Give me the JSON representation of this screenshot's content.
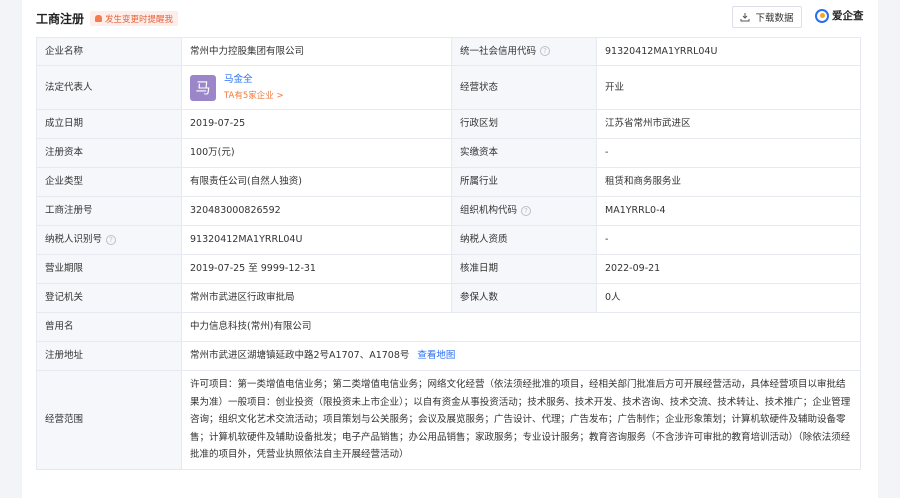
{
  "header": {
    "title": "工商注册",
    "alert": "发生变更时提醒我",
    "download_label": "下载数据",
    "logo_text": "爱企查"
  },
  "rows": [
    {
      "l1": "企业名称",
      "v1": "常州中力控股集团有限公司",
      "l2": "统一社会信用代码",
      "v2": "91320412MA1YRRL04U"
    },
    {
      "l1": "法定代表人",
      "l2": "经营状态",
      "v2": "开业"
    },
    {
      "l1": "成立日期",
      "v1": "2019-07-25",
      "l2": "行政区划",
      "v2": "江苏省常州市武进区"
    },
    {
      "l1": "注册资本",
      "v1": "100万(元)",
      "l2": "实缴资本",
      "v2": "-"
    },
    {
      "l1": "企业类型",
      "v1": "有限责任公司(自然人独资)",
      "l2": "所属行业",
      "v2": "租赁和商务服务业"
    },
    {
      "l1": "工商注册号",
      "v1": "320483000826592",
      "l2": "组织机构代码",
      "v2": "MA1YRRL0-4"
    },
    {
      "l1": "纳税人识别号",
      "v1": "91320412MA1YRRL04U",
      "l2": "纳税人资质",
      "v2": "-"
    },
    {
      "l1": "营业期限",
      "v1": "2019-07-25 至 9999-12-31",
      "l2": "核准日期",
      "v2": "2022-09-21"
    },
    {
      "l1": "登记机关",
      "v1": "常州市武进区行政审批局",
      "l2": "参保人数",
      "v2": "0人"
    }
  ],
  "legal_rep": {
    "avatar_char": "马",
    "name": "马金全",
    "sub": "TA有5家企业 >"
  },
  "former_name": {
    "label": "曾用名",
    "value": "中力信息科技(常州)有限公司"
  },
  "address": {
    "label": "注册地址",
    "value": "常州市武进区湖塘镇延政中路2号A1707、A1708号",
    "map_link": "查看地图"
  },
  "scope": {
    "label": "经营范围",
    "value": "许可项目：第一类增值电信业务；第二类增值电信业务；网络文化经营（依法须经批准的项目，经相关部门批准后方可开展经营活动，具体经营项目以审批结果为准）一般项目：创业投资（限投资未上市企业）；以自有资金从事投资活动；技术服务、技术开发、技术咨询、技术交流、技术转让、技术推广；企业管理咨询；组织文化艺术交流活动；项目策划与公关服务；会议及展览服务；广告设计、代理；广告发布；广告制作；企业形象策划；计算机软硬件及辅助设备零售；计算机软硬件及辅助设备批发；电子产品销售；办公用品销售；家政服务；专业设计服务；教育咨询服务（不含涉许可审批的教育培训活动）（除依法须经批准的项目外，凭营业执照依法自主开展经营活动）"
  },
  "colors": {
    "accent": "#2a6ff0",
    "orange": "#f0793a",
    "label_bg": "#f5f7fa"
  },
  "icons": [
    "bell-icon",
    "download-icon",
    "help-icon",
    "logo-icon"
  ]
}
